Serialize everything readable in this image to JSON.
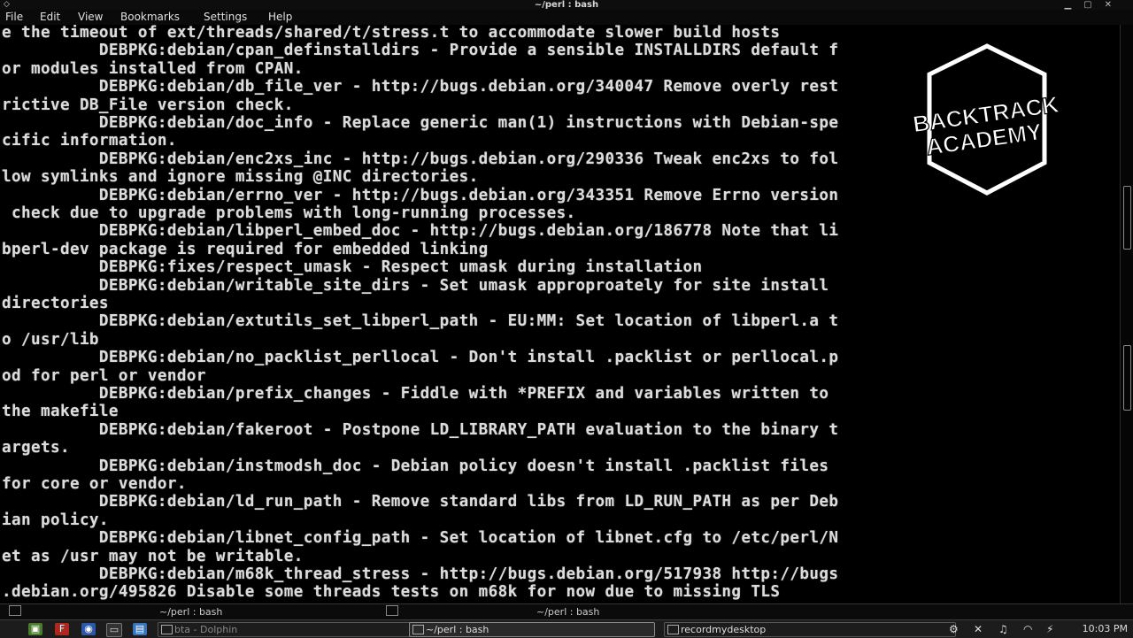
{
  "window": {
    "title": "~/perl : bash"
  },
  "menu": [
    "File",
    "Edit",
    "View",
    "Bookmarks",
    "Settings",
    "Help"
  ],
  "terminal_lines": [
    "e the timeout of ext/threads/shared/t/stress.t to accommodate slower build hosts",
    "          DEBPKG:debian/cpan_definstalldirs - Provide a sensible INSTALLDIRS default f",
    "or modules installed from CPAN.",
    "          DEBPKG:debian/db_file_ver - http://bugs.debian.org/340047 Remove overly rest",
    "rictive DB_File version check.",
    "          DEBPKG:debian/doc_info - Replace generic man(1) instructions with Debian-spe",
    "cific information.",
    "          DEBPKG:debian/enc2xs_inc - http://bugs.debian.org/290336 Tweak enc2xs to fol",
    "low symlinks and ignore missing @INC directories.",
    "          DEBPKG:debian/errno_ver - http://bugs.debian.org/343351 Remove Errno version",
    " check due to upgrade problems with long-running processes.",
    "          DEBPKG:debian/libperl_embed_doc - http://bugs.debian.org/186778 Note that li",
    "bperl-dev package is required for embedded linking",
    "          DEBPKG:fixes/respect_umask - Respect umask during installation",
    "          DEBPKG:debian/writable_site_dirs - Set umask approproately for site install",
    "directories",
    "          DEBPKG:debian/extutils_set_libperl_path - EU:MM: Set location of libperl.a t",
    "o /usr/lib",
    "          DEBPKG:debian/no_packlist_perllocal - Don't install .packlist or perllocal.p",
    "od for perl or vendor",
    "          DEBPKG:debian/prefix_changes - Fiddle with *PREFIX and variables written to",
    "the makefile",
    "          DEBPKG:debian/fakeroot - Postpone LD_LIBRARY_PATH evaluation to the binary t",
    "argets.",
    "          DEBPKG:debian/instmodsh_doc - Debian policy doesn't install .packlist files",
    "for core or vendor.",
    "          DEBPKG:debian/ld_run_path - Remove standard libs from LD_RUN_PATH as per Deb",
    "ian policy.",
    "          DEBPKG:debian/libnet_config_path - Set location of libnet.cfg to /etc/perl/N",
    "et as /usr may not be writable.",
    "          DEBPKG:debian/m68k_thread_stress - http://bugs.debian.org/517938 http://bugs",
    ".debian.org/495826 Disable some threads tests on m68k for now due to missing TLS"
  ],
  "watermark": {
    "line1": "BACKTRACK",
    "line2": "ACADEMY"
  },
  "tabs": [
    {
      "label": "~/perl : bash"
    },
    {
      "label": "~/perl : bash"
    }
  ],
  "taskbar": {
    "tasks": [
      {
        "label": "bta - Dolphin"
      },
      {
        "label": "~/perl : bash"
      },
      {
        "label": "recordmydesktop"
      }
    ],
    "clock": "10:03 PM"
  },
  "colors": {
    "background": "#000000",
    "text": "#dcdcdc",
    "taskbar": "#1c1c1c"
  }
}
